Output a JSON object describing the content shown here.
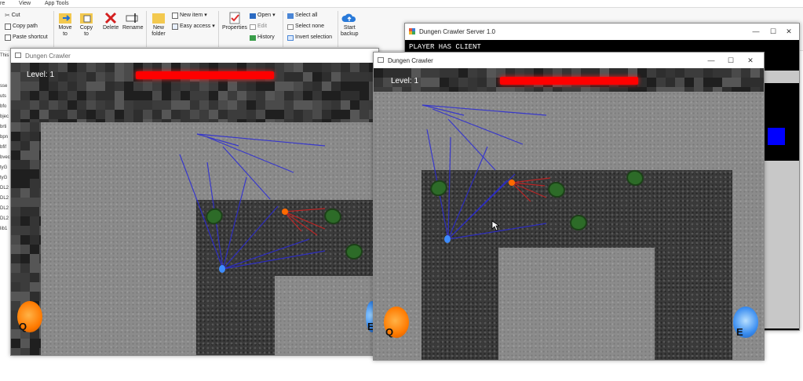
{
  "ribbon": {
    "tabs": [
      "re",
      "View",
      "App Tools"
    ],
    "clipboard": {
      "cut": "Cut",
      "copy_path": "Copy path",
      "paste_shortcut": "Paste shortcut"
    },
    "organize": {
      "move_to": "Move",
      "move_to2": "to",
      "copy_to": "Copy",
      "copy_to2": "to",
      "delete": "Delete",
      "rename": "Rename"
    },
    "new": {
      "new_folder": "New",
      "new_folder2": "folder",
      "new_item": "New item",
      "easy_access": "Easy access"
    },
    "open": {
      "properties": "Properties",
      "open": "Open",
      "edit": "Edit",
      "history": "History"
    },
    "select": {
      "select_all": "Select all",
      "select_none": "Select none",
      "invert": "Invert selection"
    },
    "backup": {
      "start": "Start",
      "backup": "backup"
    }
  },
  "left_pane": [
    "This",
    "",
    "",
    "sse",
    "uts",
    "bfo",
    "bjec",
    "brti",
    "bpn",
    "bfif",
    "bvec",
    "tyG",
    "tyG",
    "DL2",
    "DL2",
    "DL2",
    "DL2",
    "lib1"
  ],
  "server_window": {
    "title": "Dungen Crawler Server 1.0",
    "status": "PLAYER HAS CLIENT"
  },
  "client_left": {
    "title": "Dungen Crawler",
    "level": "Level: 1",
    "portal_q": "Q",
    "portal_e": "E"
  },
  "client_right": {
    "title": "Dungen Crawler",
    "level": "Level: 1",
    "portal_q": "Q",
    "portal_e": "E"
  },
  "window_controls": {
    "minimize": "—",
    "maximize": "☐",
    "close": "✕"
  },
  "colors": {
    "health_bar": "#ff0000",
    "player": "#3d8cff",
    "enemy": "#ff6a00",
    "server_bg": "#000000",
    "server_square": "#0000ff"
  }
}
